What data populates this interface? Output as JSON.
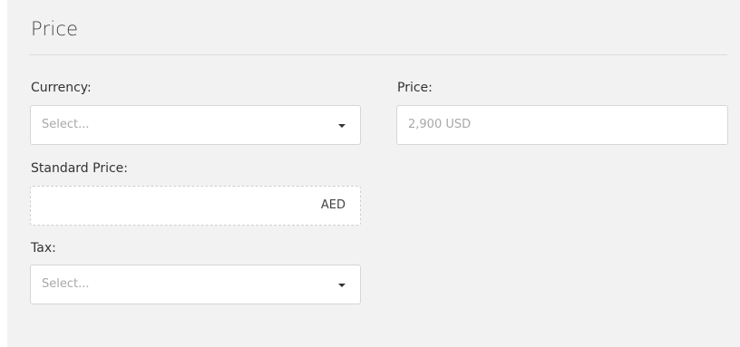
{
  "section": {
    "title": "Price"
  },
  "currency": {
    "label": "Currency:",
    "placeholder": "Select..."
  },
  "price": {
    "label": "Price:",
    "value": "2,900 USD"
  },
  "standard_price": {
    "label": "Standard Price:",
    "suffix": "AED"
  },
  "tax": {
    "label": "Tax:",
    "placeholder": "Select..."
  }
}
